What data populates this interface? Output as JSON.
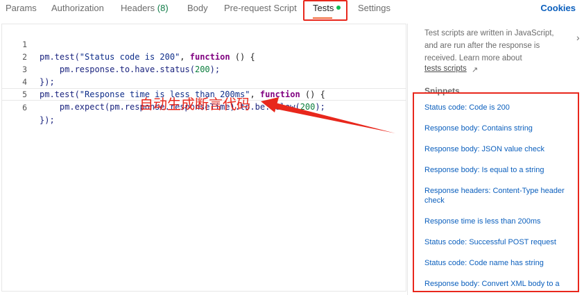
{
  "tabs": [
    {
      "label": "Params"
    },
    {
      "label": "Authorization"
    },
    {
      "label": "Headers",
      "count": "(8)"
    },
    {
      "label": "Body"
    },
    {
      "label": "Pre-request Script"
    },
    {
      "label": "Tests"
    },
    {
      "label": "Settings"
    }
  ],
  "cookies_label": "Cookies",
  "editor": {
    "line_numbers": [
      "1",
      "2",
      "3",
      "4",
      "5",
      "6"
    ],
    "l1": {
      "a": "pm.test(",
      "b": "\"Status code is 200\"",
      "c": ", ",
      "d": "function",
      "e": " () {"
    },
    "l2": {
      "a": "    pm.response.to.have.status(",
      "b": "200",
      "c": ");"
    },
    "l3": {
      "a": "});"
    },
    "l4": {
      "a": "pm.test(",
      "b": "\"Response time is less than 200ms\"",
      "c": ", ",
      "d": "function",
      "e": " () {"
    },
    "l5": {
      "a": "    pm.expect(pm.response.responseTime).to.be.below(",
      "b": "200",
      "c": ");"
    },
    "l6": {
      "a": "});"
    }
  },
  "annotation": "自动生成断言代码",
  "sidebar": {
    "help_text": "Test scripts are written in JavaScript, and are run after the response is received. Learn more about",
    "help_link": "tests scripts",
    "ext_icon": "↗",
    "chevron": "›",
    "snippets_title": "Snippets",
    "snippets": [
      "Status code: Code is 200",
      "Response body: Contains string",
      "Response body: JSON value check",
      "Response body: Is equal to a string",
      "Response headers: Content-Type header check",
      "Response time is less than 200ms",
      "Status code: Successful POST request",
      "Status code: Code name has string",
      "Response body: Convert XML body to a"
    ]
  },
  "colors": {
    "accent": "#f26b3a",
    "highlight": "#e8271c",
    "link": "#0b5fbd",
    "dot": "#0cbb52"
  }
}
